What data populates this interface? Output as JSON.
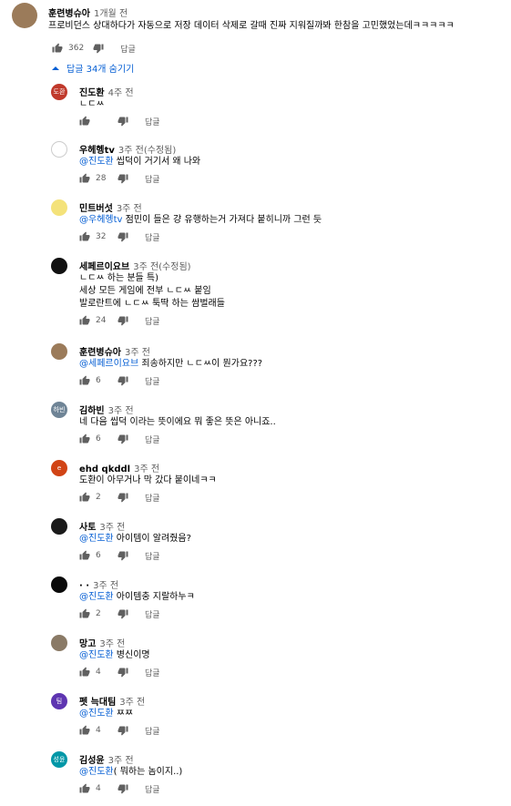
{
  "top_comment": {
    "author": "훈련병슈아",
    "time": "1개월 전",
    "text": "프로비던스 상대하다가 자동으로 저장 데이터 삭제로 갈때 진짜 지워질까봐 한참을 고민했었는데ㅋㅋㅋㅋㅋ",
    "likes": "362",
    "reply_label": "답글"
  },
  "toggle_label": "답글 34개 숨기기",
  "replies": [
    {
      "author": "진도환",
      "time": "4주 전",
      "avatar_text": "도환",
      "avatar_color": "#c0392b",
      "lines": [
        "ㄴㄷㅆ"
      ],
      "mention": "",
      "likes": "",
      "reply_label": "답글"
    },
    {
      "author": "우헤헹tv",
      "time": "3주 전(수정됨)",
      "avatar_text": "",
      "avatar_color": "#ffffff",
      "lines": [
        " 씹덕이 거기서 왜 나와"
      ],
      "mention": "@진도환",
      "likes": "28",
      "reply_label": "답글"
    },
    {
      "author": "민트버섯",
      "time": "3주 전",
      "avatar_text": "",
      "avatar_color": "#f4e27a",
      "lines": [
        " 점민이 들은 걍 유행하는거 가져다 붙히니까 그런 듯"
      ],
      "mention": "@우헤헹tv",
      "likes": "32",
      "reply_label": "답글"
    },
    {
      "author": "세페르이요브",
      "time": "3주 전(수정됨)",
      "avatar_text": "",
      "avatar_color": "#111111",
      "lines": [
        "ㄴㄷㅆ 하는 분들 특)",
        "세상 모든 게임에 전부 ㄴㄷㅆ 붙임",
        "발로란트에 ㄴㄷㅆ 툭딱 하는 쌈벌래들"
      ],
      "mention": "",
      "likes": "24",
      "reply_label": "답글"
    },
    {
      "author": "훈련병슈아",
      "time": "3주 전",
      "avatar_text": "",
      "avatar_color": "#9b7b5a",
      "lines": [
        " 죄송하지만 ㄴㄷㅆ이 뭔가요???"
      ],
      "mention": "@세페르이요브",
      "likes": "6",
      "reply_label": "답글"
    },
    {
      "author": "김하빈",
      "time": "3주 전",
      "avatar_text": "하빈",
      "avatar_color": "#6f8496",
      "lines": [
        "네 다음 씹덕 이라는 뜻이에요 뭐 좋은 뜻은 아니죠.."
      ],
      "mention": "",
      "likes": "6",
      "reply_label": "답글"
    },
    {
      "author": "ehd qkddl",
      "time": "3주 전",
      "avatar_text": "e",
      "avatar_color": "#d14415",
      "lines": [
        "도환이 아무거나 막 갔다 붙이네ㅋㅋ"
      ],
      "mention": "",
      "likes": "2",
      "reply_label": "답글"
    },
    {
      "author": "사토",
      "time": "3주 전",
      "avatar_text": "",
      "avatar_color": "#1a1a1a",
      "lines": [
        " 아이템이 알려줬음?"
      ],
      "mention": "@진도환",
      "likes": "6",
      "reply_label": "답글"
    },
    {
      "author": "· ·",
      "time": "3주 전",
      "avatar_text": "",
      "avatar_color": "#0a0a0a",
      "lines": [
        " 아이템충 지랄하누ㅋ"
      ],
      "mention": "@진도환",
      "likes": "2",
      "reply_label": "답글"
    },
    {
      "author": "망고",
      "time": "3주 전",
      "avatar_text": "",
      "avatar_color": "#8a7a66",
      "lines": [
        " 병신이명"
      ],
      "mention": "@진도환",
      "likes": "4",
      "reply_label": "답글"
    },
    {
      "author": "펫 늑대팀",
      "time": "3주 전",
      "avatar_text": "팀",
      "avatar_color": "#5e35b1",
      "lines": [
        " ㅉㅉ"
      ],
      "mention": "@진도환",
      "likes": "4",
      "reply_label": "답글"
    },
    {
      "author": "김성윤",
      "time": "3주 전",
      "avatar_text": "성윤",
      "avatar_color": "#0097a7",
      "lines": [
        "( 뭐하는 놈이지..)"
      ],
      "mention": "@진도환",
      "likes": "4",
      "reply_label": "답글"
    }
  ],
  "colors": {
    "link": "#065fd4",
    "meta": "#606060"
  }
}
